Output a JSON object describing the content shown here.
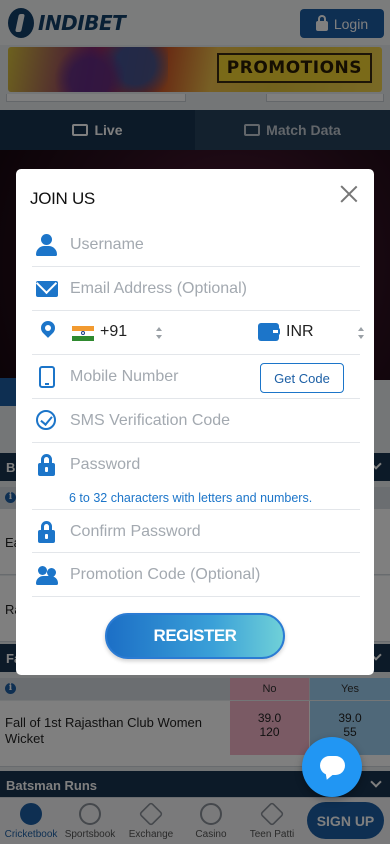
{
  "header": {
    "brand": "INDIBET",
    "login_label": "Login"
  },
  "promo": {
    "label": "PROMOTIONS"
  },
  "tabs": [
    {
      "label": "Live"
    },
    {
      "label": "Match Data"
    }
  ],
  "background": {
    "section_partial_1": "B",
    "row_partial_1": "Ea",
    "row_partial_2": "Ra",
    "section_partial_2": "Fa",
    "no_label": "No",
    "yes_label": "Yes",
    "market_name": "Fall of 1st Rajasthan Club Women Wicket",
    "no_odds": "39.0",
    "no_stake": "120",
    "yes_odds": "39.0",
    "yes_stake": "55",
    "batsman_section": "Batsman Runs"
  },
  "modal": {
    "title": "JOIN US",
    "username_placeholder": "Username",
    "email_placeholder": "Email Address (Optional)",
    "dial_code": "+91",
    "currency": "INR",
    "mobile_placeholder": "Mobile Number",
    "get_code_label": "Get Code",
    "sms_placeholder": "SMS Verification Code",
    "password_placeholder": "Password",
    "password_hint": "6 to 32 characters with letters and numbers.",
    "confirm_placeholder": "Confirm Password",
    "promo_placeholder": "Promotion Code (Optional)",
    "register_label": "REGISTER"
  },
  "bottom_nav": {
    "items": [
      {
        "label": "Cricketbook"
      },
      {
        "label": "Sportsbook"
      },
      {
        "label": "Exchange"
      },
      {
        "label": "Casino"
      },
      {
        "label": "Teen Patti"
      }
    ],
    "signup_label": "SIGN UP"
  },
  "colors": {
    "brand": "#12406b",
    "accent": "#1c75c9",
    "no": "#f4b4c9",
    "yes": "#9fd0f3"
  }
}
